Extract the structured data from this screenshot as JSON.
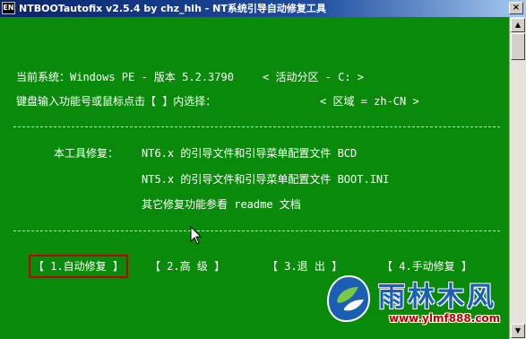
{
  "window": {
    "title": "NTBOOTautofix v2.5.4 by chz_hlh - NT系统引导自动修复工具",
    "app_icon_label": "EN",
    "close_label": "×"
  },
  "info": {
    "system_label": "当前系统：Windows PE - 版本 5.2.3790",
    "active_partition": "< 活动分区 - C: >",
    "prompt": "键盘输入功能号或鼠标点击【 】内选择：",
    "locale": "< 区域 = zh-CN >"
  },
  "repair": {
    "heading": "本工具修复：",
    "items": [
      "NT6.x 的引导文件和引导菜单配置文件 BCD",
      "NT5.x 的引导文件和引导菜单配置文件 BOOT.INI",
      "其它修复功能参看 readme 文档"
    ]
  },
  "menu": {
    "items": [
      "【 1.自动修复 】",
      "【 2.高  级 】",
      "【 3.退  出 】",
      "【 4.手动修复 】"
    ],
    "selected_index": 0
  },
  "watermark": {
    "brand": "雨林木风",
    "url": "www.ylmf888.com"
  },
  "colors": {
    "console_bg": "#0a8a0a",
    "text": "#ffffff",
    "selection_border": "#c00000",
    "brand_blue": "#1a5fb4"
  },
  "scrollbar": {
    "up_icon": "▲",
    "down_icon": "▼"
  }
}
